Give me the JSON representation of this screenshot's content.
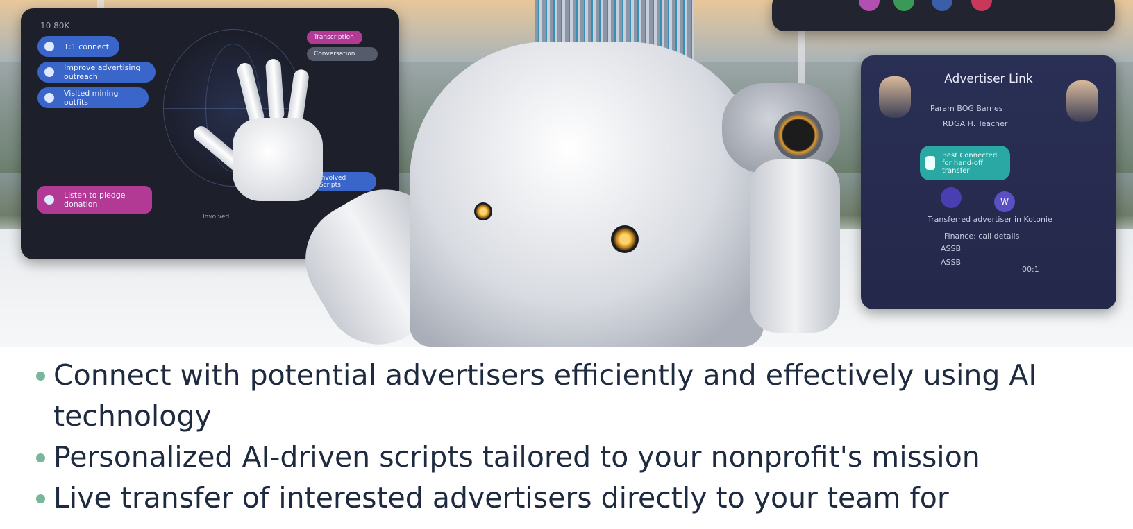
{
  "left_screen": {
    "corner_label": "10 80K",
    "pills": [
      "1:1 connect",
      "Improve advertising outreach",
      "Visited mining outfits"
    ],
    "right_tags": [
      "Transcription",
      "Conversation"
    ],
    "footer_pill": "Listen to pledge donation",
    "right_pill": "Involved Scripts",
    "caption": "Involved"
  },
  "right_screen": {
    "title": "Advertiser Link",
    "line1": "Param BOG Barnes",
    "line2": "RDGA H. Teacher",
    "teal_button": "Best Connected for hand-off transfer",
    "round_button_label": "W",
    "line3": "Transferred advertiser in Kotonie",
    "line4": "Finance: call details",
    "line5": "ASSB",
    "footer_left": "ASSB",
    "footer_right": "00:1"
  },
  "bullets": [
    "Connect with potential advertisers efficiently and effectively using AI technology",
    "Personalized AI-driven scripts tailored to your nonprofit's mission",
    "Live transfer of interested advertisers directly to your team for"
  ],
  "colors": {
    "bullet_dot": "#7ab69c",
    "text": "#1e2a40",
    "teal": "#2aa8a4",
    "pill_blue": "#3b66c9",
    "pill_pink": "#b23a94"
  }
}
